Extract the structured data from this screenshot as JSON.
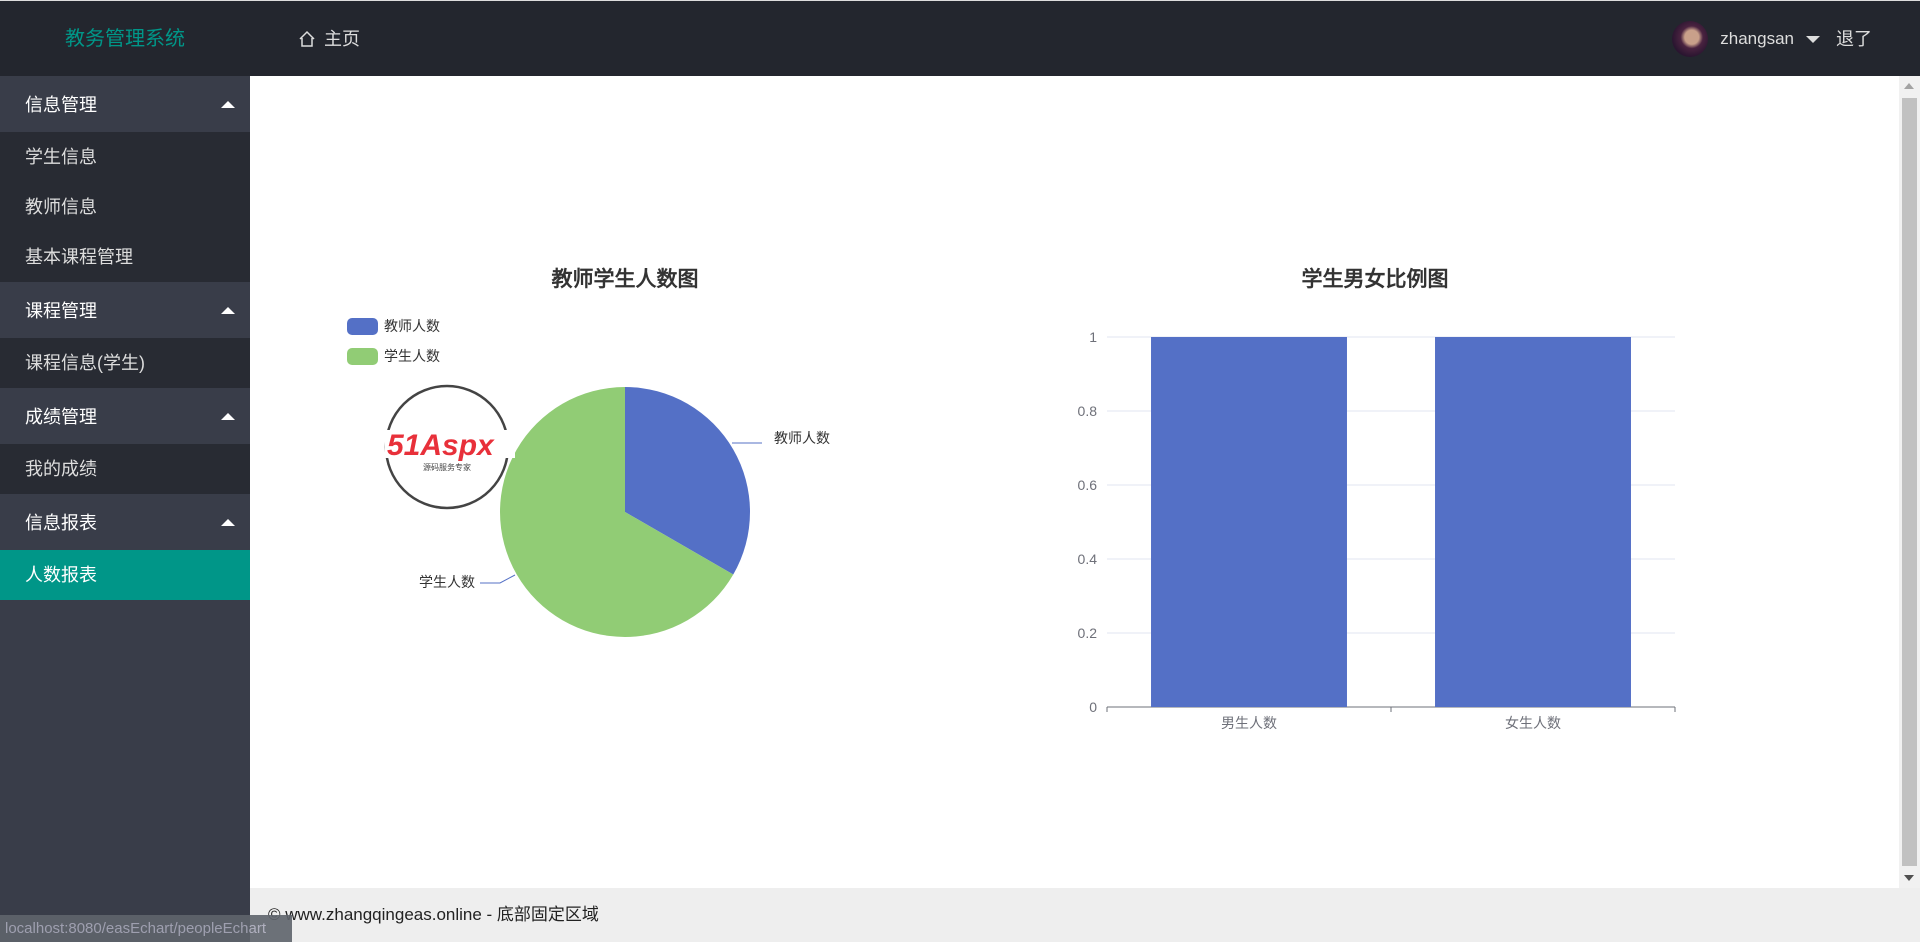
{
  "header": {
    "title": "教务管理系统",
    "home": "主页",
    "username": "zhangsan",
    "logout": "退了"
  },
  "sidebar": {
    "groups": [
      {
        "label": "信息管理",
        "items": [
          "学生信息",
          "教师信息",
          "基本课程管理"
        ]
      },
      {
        "label": "课程管理",
        "items": [
          "课程信息(学生)"
        ]
      },
      {
        "label": "成绩管理",
        "items": [
          "我的成绩"
        ]
      },
      {
        "label": "信息报表",
        "items": [
          "人数报表"
        ]
      }
    ],
    "active": "人数报表"
  },
  "watermark": {
    "text": "51Aspx",
    "sub": "源码服务专家"
  },
  "footer": "© www.zhangqingeas.online - 底部固定区域",
  "status_url": "localhost:8080/easEchart/peopleEchart",
  "colors": {
    "blue": "#5470c6",
    "green": "#91cc75",
    "accent": "#009688"
  },
  "chart_data": [
    {
      "type": "pie",
      "title": "教师学生人数图",
      "legend": [
        "教师人数",
        "学生人数"
      ],
      "legend_position": "top-left",
      "slices": [
        {
          "name": "教师人数",
          "value": 1
        },
        {
          "name": "学生人数",
          "value": 2
        }
      ]
    },
    {
      "type": "bar",
      "title": "学生男女比例图",
      "categories": [
        "男生人数",
        "女生人数"
      ],
      "values": [
        1,
        1
      ],
      "ylim": [
        0,
        1
      ],
      "yticks": [
        "0",
        "0.2",
        "0.4",
        "0.6",
        "0.8",
        "1"
      ],
      "grid": true
    }
  ]
}
